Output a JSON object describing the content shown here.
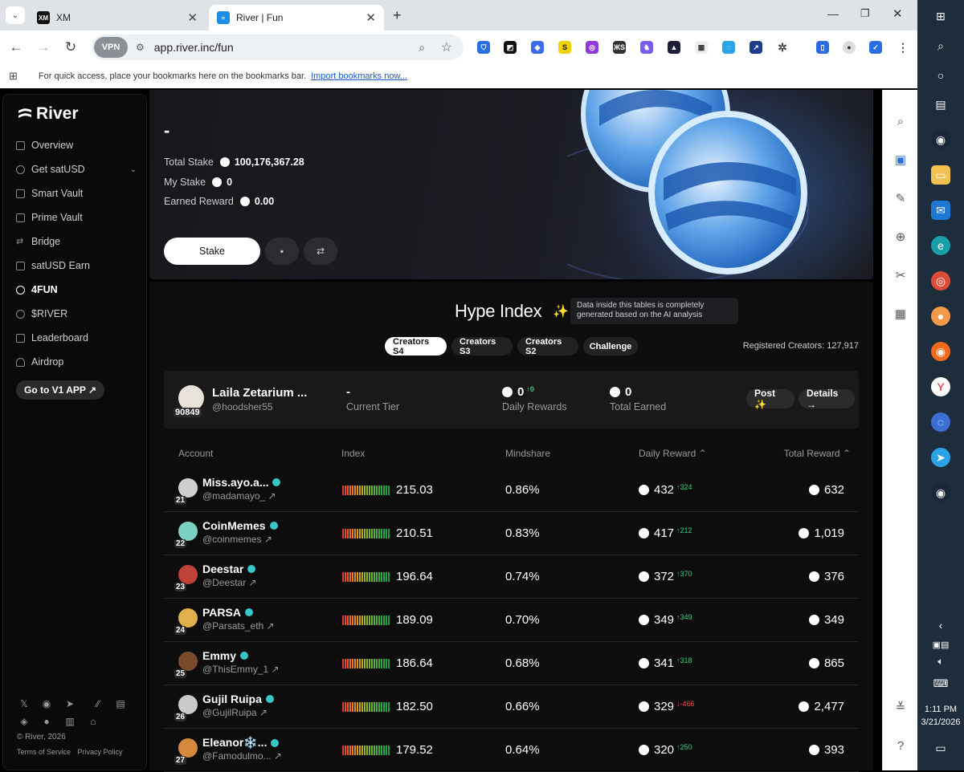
{
  "browser": {
    "tabs": [
      {
        "title": "XM",
        "icon": "xm-favicon"
      },
      {
        "title": "River | Fun",
        "icon": "river-favicon"
      }
    ],
    "vpn_label": "VPN",
    "url": "app.river.inc/fun",
    "bookmarks_text": "For quick access, place your bookmarks here on the bookmarks bar.",
    "bookmarks_link": "Import bookmarks now..."
  },
  "sidebar": {
    "brand": "River",
    "items": [
      {
        "label": "Overview"
      },
      {
        "label": "Get satUSD"
      },
      {
        "label": "Smart Vault"
      },
      {
        "label": "Prime Vault"
      },
      {
        "label": "Bridge"
      },
      {
        "label": "satUSD Earn"
      },
      {
        "label": "4FUN"
      },
      {
        "label": "$RIVER"
      },
      {
        "label": "Leaderboard"
      },
      {
        "label": "Airdrop"
      }
    ],
    "v1_button": "Go to V1 APP ↗",
    "copyright": "© River, 2026",
    "terms": "Terms of Service",
    "privacy": "Privacy Policy"
  },
  "hero": {
    "title": "-",
    "total_stake_label": "Total Stake",
    "total_stake_value": "100,176,367.28",
    "my_stake_label": "My Stake",
    "my_stake_value": "0",
    "earned_label": "Earned Reward",
    "earned_value": "0.00",
    "stake_button": "Stake"
  },
  "hype": {
    "title": "Hype Index",
    "ai_note": "Data inside this tables is completely generated based on the AI analysis",
    "tabs": [
      "Creators S4",
      "Creators S3",
      "Creators S2",
      "Challenge"
    ],
    "registered": "Registered Creators: 127,917",
    "me": {
      "name": "Laila Zetarium ...",
      "handle": "@hoodsher55",
      "rank": "90849",
      "tier_value": "-",
      "tier_label": "Current Tier",
      "daily_value": "0",
      "daily_delta": "↑0",
      "daily_label": "Daily Rewards",
      "total_value": "0",
      "total_label": "Total Earned",
      "post_btn": "Post ✨",
      "details_btn": "Details →"
    },
    "columns": {
      "account": "Account",
      "index": "Index",
      "mindshare": "Mindshare",
      "daily": "Daily Reward ⌃",
      "total": "Total Reward ⌃"
    },
    "rows": [
      {
        "rank": "21",
        "name": "Miss.ayo.a...",
        "handle": "@madamayo_ ↗",
        "index": "215.03",
        "mindshare": "0.86%",
        "daily": "432",
        "delta": "↑324",
        "dir": "up",
        "total": "632"
      },
      {
        "rank": "22",
        "name": "CoinMemes",
        "handle": "@coinmemes ↗",
        "index": "210.51",
        "mindshare": "0.83%",
        "daily": "417",
        "delta": "↑212",
        "dir": "up",
        "total": "1,019"
      },
      {
        "rank": "23",
        "name": "Deestar",
        "handle": "@Deestar ↗",
        "index": "196.64",
        "mindshare": "0.74%",
        "daily": "372",
        "delta": "↑370",
        "dir": "up",
        "total": "376"
      },
      {
        "rank": "24",
        "name": "PARSA",
        "handle": "@Parsats_eth ↗",
        "index": "189.09",
        "mindshare": "0.70%",
        "daily": "349",
        "delta": "↑349",
        "dir": "up",
        "total": "349"
      },
      {
        "rank": "25",
        "name": "Emmy",
        "handle": "@ThisEmmy_1 ↗",
        "index": "186.64",
        "mindshare": "0.68%",
        "daily": "341",
        "delta": "↑318",
        "dir": "up",
        "total": "865"
      },
      {
        "rank": "26",
        "name": "Gujil Ruipa",
        "handle": "@GujilRuipa ↗",
        "index": "182.50",
        "mindshare": "0.66%",
        "daily": "329",
        "delta": "↓-466",
        "dir": "down",
        "total": "2,477"
      },
      {
        "rank": "27",
        "name": "Eleanor❄️...",
        "handle": "@Famodulmo... ↗",
        "index": "179.52",
        "mindshare": "0.64%",
        "daily": "320",
        "delta": "↑250",
        "dir": "up",
        "total": "393"
      }
    ]
  },
  "taskbar": {
    "time": "1:11 PM",
    "date": "3/21/2026"
  },
  "colors": {
    "up": "#35d07f",
    "down": "#ff4d4d",
    "accent": "#38c6c6"
  }
}
